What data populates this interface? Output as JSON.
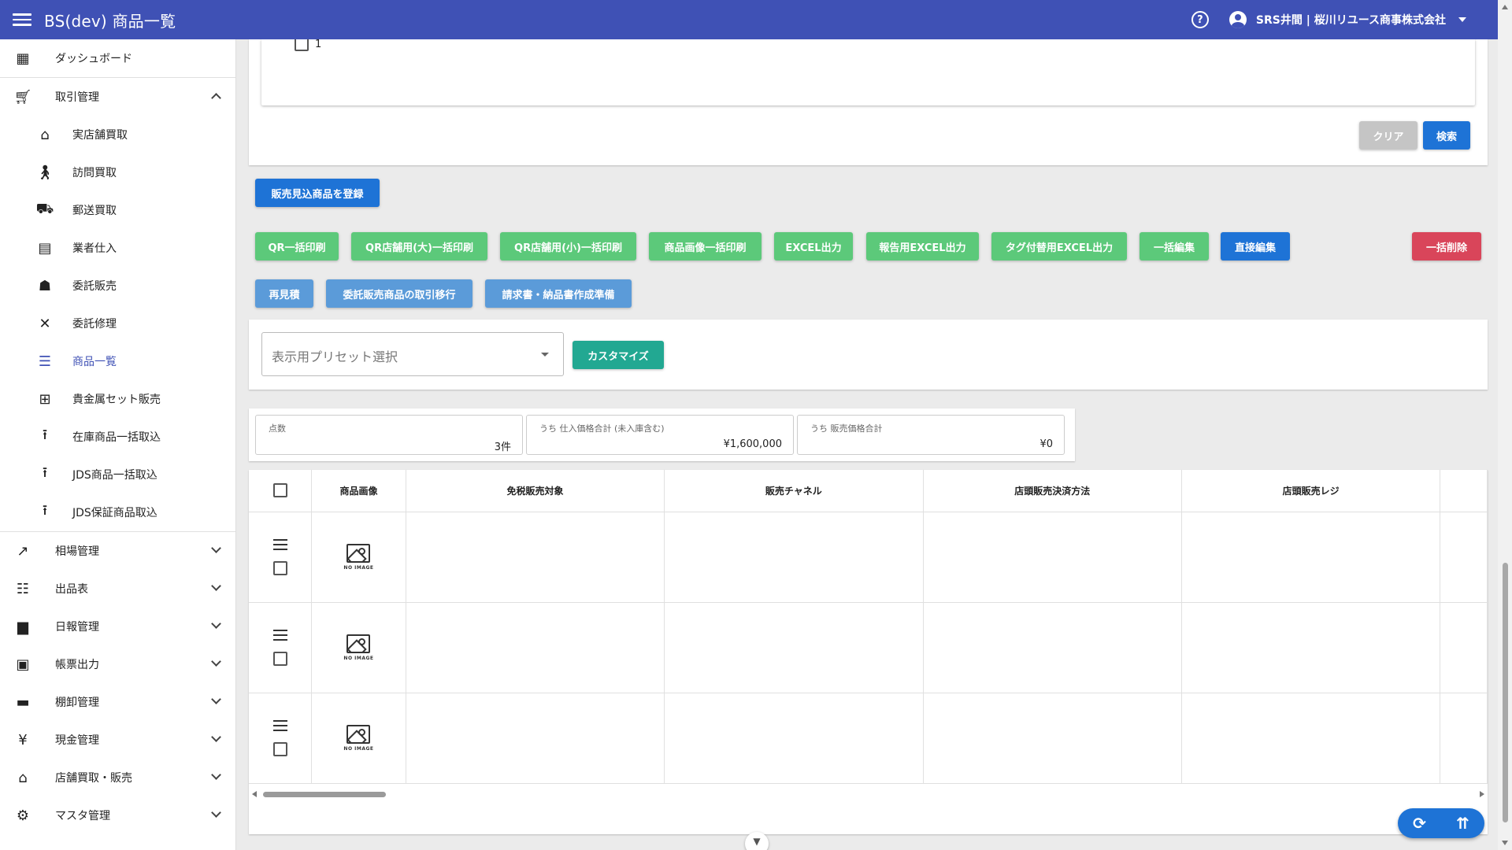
{
  "header": {
    "title": "BS(dev) 商品一覧",
    "user": "SRS井間 | 桜川リユース商事株式会社",
    "help_icon": "question-circle-icon",
    "account_icon": "account-circle-icon"
  },
  "sidebar": {
    "dashboard": "ダッシュボード",
    "transactions": "取引管理",
    "sub_items": [
      {
        "label": "実店舗買取",
        "icon": "store-icon"
      },
      {
        "label": "訪問買取",
        "icon": "walk-icon"
      },
      {
        "label": "郵送買取",
        "icon": "truck-icon"
      },
      {
        "label": "業者仕入",
        "icon": "building-icon"
      },
      {
        "label": "委託販売",
        "icon": "stand-icon"
      },
      {
        "label": "委託修理",
        "icon": "tools-icon"
      },
      {
        "label": "商品一覧",
        "icon": "list-icon"
      },
      {
        "label": "貴金属セット販売",
        "icon": "grid-icon"
      },
      {
        "label": "在庫商品一括取込",
        "icon": "upload-icon"
      },
      {
        "label": "JDS商品一括取込",
        "icon": "upload-icon"
      },
      {
        "label": "JDS保証商品取込",
        "icon": "upload-icon"
      }
    ],
    "groups": [
      {
        "label": "相場管理",
        "icon": "trending-icon"
      },
      {
        "label": "出品表",
        "icon": "checklist-icon"
      },
      {
        "label": "日報管理",
        "icon": "document-icon"
      },
      {
        "label": "帳票出力",
        "icon": "note-icon"
      },
      {
        "label": "棚卸管理",
        "icon": "archive-icon"
      },
      {
        "label": "現金管理",
        "icon": "yen-icon"
      },
      {
        "label": "店舗買取・販売",
        "icon": "store-icon"
      },
      {
        "label": "マスタ管理",
        "icon": "gear-icon"
      }
    ]
  },
  "filter": {
    "checkbox_label": "1",
    "clear": "クリア",
    "search": "検索"
  },
  "actions": {
    "register": "販売見込商品を登録",
    "row1": [
      "QR一括印刷",
      "QR店舗用(大)一括印刷",
      "QR店舗用(小)一括印刷",
      "商品画像一括印刷",
      "EXCEL出力",
      "報告用EXCEL出力",
      "タグ付替用EXCEL出力",
      "一括編集",
      "直接編集"
    ],
    "delete": "一括削除",
    "row2": [
      "再見積",
      "委託販売商品の取引移行",
      "請求書・納品書作成準備"
    ]
  },
  "preset": {
    "placeholder": "表示用プリセット選択",
    "customize": "カスタマイズ"
  },
  "summary": [
    {
      "caption": "点数",
      "value": "3件"
    },
    {
      "caption": "うち 仕入価格合計 (未入庫含む)",
      "value": "¥1,600,000"
    },
    {
      "caption": "うち 販売価格合計",
      "value": "¥0"
    }
  ],
  "table": {
    "headers": [
      "商品画像",
      "免税販売対象",
      "販売チャネル",
      "店頭販売決済方法",
      "店頭販売レジ"
    ],
    "no_image": "NO IMAGE",
    "row_count": 3
  },
  "fab": {
    "refresh": "⟳",
    "top": "⇈"
  },
  "colors": {
    "primary": "#3f51b5",
    "green": "#5cc97a",
    "blue": "#1e73d6",
    "red": "#d9455a",
    "teal": "#22a892"
  }
}
